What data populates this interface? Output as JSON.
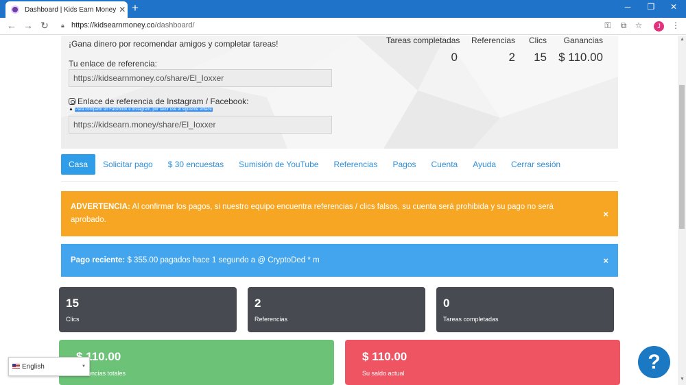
{
  "browser": {
    "tab_title": "Dashboard | Kids Earn Money",
    "tab_close": "✕",
    "new_tab": "+",
    "url_host": "https://kidsearnmoney.co",
    "url_path": "/dashboard/",
    "profile_initial": "J"
  },
  "hero": {
    "tagline": "¡Gana dinero por recomendar amigos y completar tareas!",
    "referral_label": "Tu enlace de referencia:",
    "referral_link": "https://kidsearnmoney.co/share/El_Ioxxer",
    "instagram_label": "Enlace de referencia de Instagram / Facebook:",
    "instagram_note": "Para compartir en Facebook e Instagram, por favor use el siguiente enlace",
    "instagram_link": "https://kidsearn.money/share/El_Ioxxer"
  },
  "summary": {
    "tasks_label": "Tareas completadas",
    "tasks_value": "0",
    "referrals_label": "Referencias",
    "referrals_value": "2",
    "clicks_label": "Clics",
    "clicks_value": "15",
    "earnings_label": "Ganancias",
    "earnings_value": "$ 110.00"
  },
  "nav": {
    "items": [
      {
        "label": "Casa"
      },
      {
        "label": "Solicitar pago"
      },
      {
        "label": "$ 30 encuestas"
      },
      {
        "label": "Sumisión de YouTube"
      },
      {
        "label": "Referencias"
      },
      {
        "label": "Pagos"
      },
      {
        "label": "Cuenta"
      },
      {
        "label": "Ayuda"
      },
      {
        "label": "Cerrar sesión"
      }
    ]
  },
  "alerts": {
    "warning_title": "ADVERTENCIA:",
    "warning_text": "Al confirmar los pagos, si nuestro equipo encuentra referencias / clics falsos, su cuenta será prohibida y su pago no será aprobado.",
    "info_title": "Pago reciente:",
    "info_text": "$ 355.00 pagados hace 1 segundo a @ CryptoDed * m",
    "close": "×"
  },
  "cards": {
    "clicks_num": "15",
    "clicks_label": "Clics",
    "referrals_num": "2",
    "referrals_label": "Referencias",
    "tasks_num": "0",
    "tasks_label": "Tareas completadas",
    "total_num": "$ 110.00",
    "total_label": "Ganancias totales",
    "balance_num": "$ 110.00",
    "balance_label": "Su saldo actual"
  },
  "language": {
    "selected": "English"
  },
  "help": {
    "label": "?"
  },
  "colors": {
    "chrome_blue": "#1f73c9",
    "nav_active": "#2f9de8",
    "warning": "#f6a623",
    "info": "#42a5ed",
    "dark_card": "#474b51",
    "green_card": "#6cc276",
    "red_card": "#ef5463",
    "help_bubble": "#1b78c3"
  }
}
